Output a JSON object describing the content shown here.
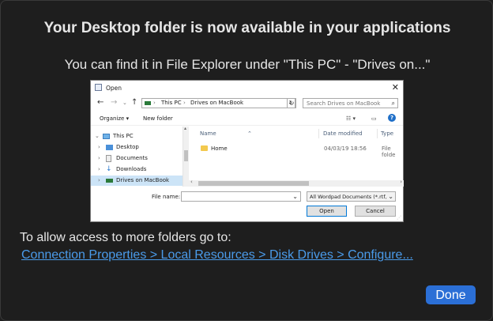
{
  "sheet": {
    "title": "Your Desktop folder is now available in your applications",
    "subtitle": "You can find it in File Explorer under \"This PC\" - \"Drives on...\"",
    "access_text": "To allow access to more folders go to:",
    "access_link": "Connection Properties > Local Resources > Disk Drives > Configure...",
    "done_label": "Done"
  },
  "dialog": {
    "title": "Open",
    "address": [
      "This PC",
      "Drives on MacBook"
    ],
    "search_placeholder": "Search Drives on MacBook",
    "organize": "Organize ▾",
    "new_folder": "New folder",
    "tree": [
      {
        "label": "This PC",
        "icon": "pc-icon",
        "expanded": true
      },
      {
        "label": "Desktop",
        "icon": "desktop-icon"
      },
      {
        "label": "Documents",
        "icon": "documents-icon"
      },
      {
        "label": "Downloads",
        "icon": "downloads-icon"
      },
      {
        "label": "Drives on MacBook",
        "icon": "drive-icon",
        "selected": true
      }
    ],
    "columns": {
      "name": "Name",
      "date": "Date modified",
      "type": "Type"
    },
    "files": [
      {
        "name": "Home",
        "date": "04/03/19 18:56",
        "type": "File folde"
      }
    ],
    "file_name_label": "File name:",
    "file_type": "All Wordpad Documents (*.rtf,",
    "open_label": "Open",
    "cancel_label": "Cancel"
  },
  "colors": {
    "accent": "#2b6fd6",
    "link": "#4a9bea",
    "background": "#1e1e1e"
  }
}
